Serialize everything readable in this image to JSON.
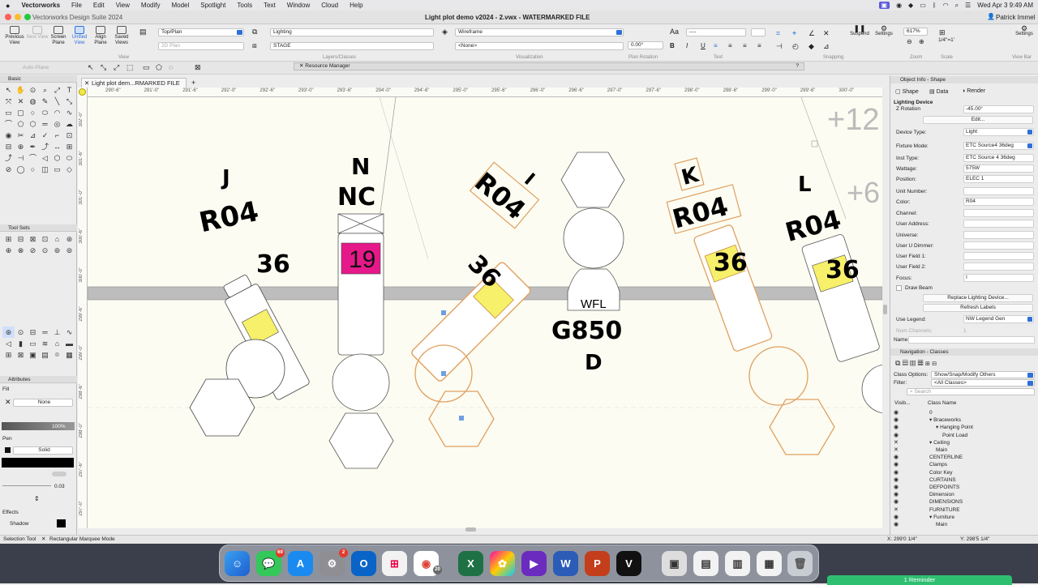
{
  "menubar": {
    "app_name": "Vectorworks",
    "items": [
      "File",
      "Edit",
      "View",
      "Modify",
      "Model",
      "Spotlight",
      "Tools",
      "Text",
      "Window",
      "Cloud",
      "Help"
    ],
    "datetime": "Wed Apr 3  9:49 AM"
  },
  "window": {
    "app_title": "Vectorworks Design Suite 2024",
    "doc_title": "Light plot demo v2024 - 2.vwx - WATERMARKED FILE",
    "user": "Patrick Immel"
  },
  "toolbar": {
    "previous_view": "Previous View",
    "next_view": "Next View",
    "screen_plane": "Screen Plane",
    "unified_view": "Unified View",
    "align_plane": "Align Plane",
    "saved_views": "Saved Views",
    "view_group": "View",
    "layer_value": "Top/Plan",
    "plane_value": "2D Plan",
    "class_value": "Lighting",
    "layer2_value": "STAGE",
    "layers_group": "Layers/Classes",
    "render_value": "Wireframe",
    "none_value": "<None>",
    "visualization_group": "Visualization",
    "rotation_value": "0.00°",
    "rotation_group": "Plan Rotation",
    "text_group": "Text",
    "snapping_group": "Snapping",
    "suspend": "Suspend",
    "settings": "Settings",
    "zoom_value": "617%",
    "zoom_group": "Zoom",
    "scale_value": "1/4\"=1'",
    "scale_group": "Scale",
    "settings2": "Settings",
    "viewbar_group": "View Bar",
    "auto_plane": "Auto-Plane"
  },
  "resource_manager": {
    "title": "Resource Manager"
  },
  "left_panel": {
    "basic_title": "Basic",
    "toolsets_title": "Tool Sets",
    "attributes_title": "Attributes",
    "fill_label": "Fill",
    "fill_value": "None",
    "opacity_value": "100%",
    "pen_label": "Pen",
    "pen_value": "Solid",
    "thickness_value": "0.03",
    "effects_label": "Effects",
    "shadow_label": "Shadow"
  },
  "document_tab": {
    "label": "Light plot dem...RMARKED FILE"
  },
  "ruler": {
    "top": [
      "290'-6\"",
      "291'-0\"",
      "291'-6\"",
      "292'-0\"",
      "292'-6\"",
      "293'-0\"",
      "293'-6\"",
      "294'-0\"",
      "294'-6\"",
      "295'-0\"",
      "295'-6\"",
      "296'-0\"",
      "296'-6\"",
      "297'-0\"",
      "297'-6\"",
      "298'-0\"",
      "298'-6\"",
      "299'-0\"",
      "299'-6\"",
      "300'-0\""
    ],
    "left": [
      "302'-0\"",
      "301'-6\"",
      "301'-0\"",
      "300'-6\"",
      "300'-0\"",
      "299'-6\"",
      "299'-0\"",
      "298'-6\"",
      "298'-0\"",
      "297'-6\"",
      "297'-0\""
    ]
  },
  "canvas": {
    "fixtures": [
      {
        "letter": "J",
        "color": "R04",
        "channel": "36"
      },
      {
        "letter": "N",
        "color": "NC",
        "channel": "19"
      },
      {
        "letter": "I",
        "color": "R04",
        "channel": "36"
      },
      {
        "letter": "K",
        "color": "R04",
        "channel": "36"
      },
      {
        "letter": "L",
        "color": "R04",
        "channel": "36"
      }
    ],
    "center_unit": {
      "type": "WFL",
      "color": "G850",
      "letter": "D"
    },
    "dim_labels": [
      "+12",
      "+6"
    ]
  },
  "object_info": {
    "title": "Object Info - Shape",
    "tabs": [
      "Shape",
      "Data",
      "Render"
    ],
    "object_type": "Lighting Device",
    "z_rotation_label": "Z Rotation",
    "z_rotation_value": "-45.00°",
    "edit_button": "Edit...",
    "fields": [
      {
        "label": "Device Type:",
        "value": "Light"
      },
      {
        "label": "Fixture Mode:",
        "value": "ETC Source4 36deg"
      },
      {
        "label": "Inst Type:",
        "value": "ETC Source 4 36deg"
      },
      {
        "label": "Wattage:",
        "value": "575W"
      },
      {
        "label": "Position:",
        "value": "ELEC 1"
      },
      {
        "label": "Unit Number:",
        "value": ""
      },
      {
        "label": "Color:",
        "value": "R04"
      },
      {
        "label": "Channel:",
        "value": ""
      },
      {
        "label": "User Address:",
        "value": ""
      },
      {
        "label": "Universe:",
        "value": ""
      },
      {
        "label": "User U Dimmer:",
        "value": ""
      },
      {
        "label": "User Field 1:",
        "value": ""
      },
      {
        "label": "User Field 2:",
        "value": ""
      },
      {
        "label": "Focus:",
        "value": "I"
      }
    ],
    "draw_beam": "Draw Beam",
    "replace_button": "Replace Lighting Device...",
    "refresh_button": "Refresh Labels",
    "use_legend_label": "Use Legend:",
    "use_legend_value": "NW Legend Gen",
    "num_channels_label": "Num Channels:",
    "num_channels_value": "1",
    "name_label": "Name:"
  },
  "navigation": {
    "title": "Navigation - Classes",
    "class_options_label": "Class Options:",
    "class_options_value": "Show/Snap/Modify Others",
    "filter_label": "Filter:",
    "filter_value": "<All Classes>",
    "search_placeholder": "Search",
    "col_visibility": "Visib...",
    "col_class_name": "Class Name",
    "classes": [
      {
        "name": "0",
        "indent": 0,
        "vis": "eye"
      },
      {
        "name": "▾ Braceworks",
        "indent": 0,
        "vis": "eye"
      },
      {
        "name": "▾ Hanging Point",
        "indent": 1,
        "vis": "eye"
      },
      {
        "name": "Point Load",
        "indent": 2,
        "vis": "eye"
      },
      {
        "name": "▾ Ceiling",
        "indent": 0,
        "vis": "x"
      },
      {
        "name": "Main",
        "indent": 1,
        "vis": "x"
      },
      {
        "name": "CENTERLINE",
        "indent": 0,
        "vis": "eye"
      },
      {
        "name": "Clamps",
        "indent": 0,
        "vis": "eye"
      },
      {
        "name": "Color Key",
        "indent": 0,
        "vis": "eye"
      },
      {
        "name": "CURTAINS",
        "indent": 0,
        "vis": "eye"
      },
      {
        "name": "DEFPOINTS",
        "indent": 0,
        "vis": "eye"
      },
      {
        "name": "Dimension",
        "indent": 0,
        "vis": "eye"
      },
      {
        "name": "DIMENSIONS",
        "indent": 0,
        "vis": "eye"
      },
      {
        "name": "FURNITURE",
        "indent": 0,
        "vis": "x"
      },
      {
        "name": "▾ Furniture",
        "indent": 0,
        "vis": "eye"
      },
      {
        "name": "Main",
        "indent": 1,
        "vis": "eye"
      }
    ]
  },
  "status": {
    "tool": "Selection Tool",
    "mode": "Rectangular Marquee Mode",
    "x_coord": "X: 299'0 1/4\"",
    "y_coord": "Y: 298'5 1/4\""
  },
  "dock": {
    "messages_badge": "69",
    "settings_badge": "2",
    "chrome_badge": "20",
    "reminder": "1 Reminder"
  },
  "colors": {
    "accent": "#2f6fdc",
    "channel_yellow": "#f6f06a",
    "channel_magenta": "#e6198a",
    "selection_orange": "#e0a060",
    "canvas_bg": "#fcfcf2",
    "pipe_gray": "#bdbdbd"
  }
}
